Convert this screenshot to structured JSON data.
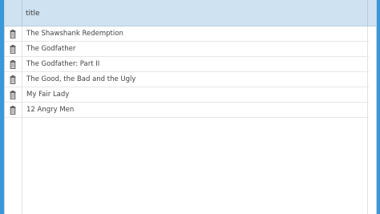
{
  "table": {
    "columns": [
      "title"
    ],
    "rows": [
      {
        "title": "The Shawshank Redemption",
        "action_icon": "trash-icon"
      },
      {
        "title": "The Godfather",
        "action_icon": "trash-icon"
      },
      {
        "title": "The Godfather: Part II",
        "action_icon": "trash-icon"
      },
      {
        "title": "The Good, the Bad and the Ugly",
        "action_icon": "trash-icon"
      },
      {
        "title": "My Fair Lady",
        "action_icon": "trash-icon"
      },
      {
        "title": "12 Angry Men",
        "action_icon": "trash-icon"
      }
    ]
  },
  "colors": {
    "background": "#3a97d8",
    "header": "#cfe2f1"
  }
}
